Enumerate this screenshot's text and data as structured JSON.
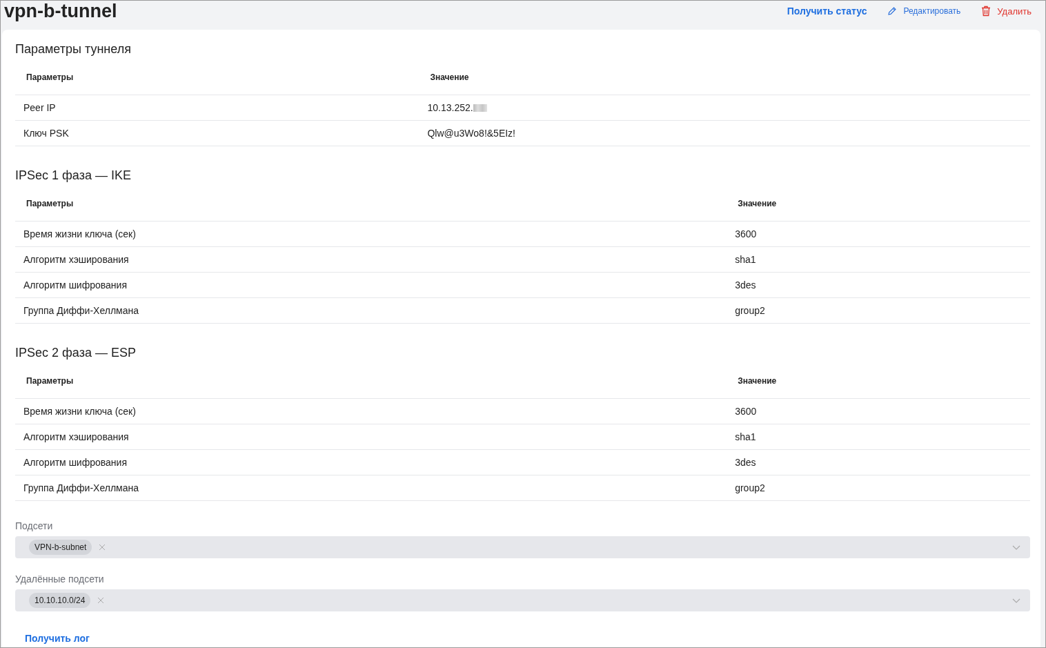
{
  "page": {
    "title": "vpn-b-tunnel",
    "actions": [
      {
        "kind": "status",
        "label": "Получить статус"
      },
      {
        "kind": "edit",
        "label": "Редактировать"
      },
      {
        "kind": "delete",
        "label": "Удалить"
      }
    ]
  },
  "sections": [
    {
      "title": "Параметры туннеля",
      "columns": [
        "Параметры",
        "Значение"
      ],
      "rows": [
        {
          "cells": [
            "Peer IP",
            "10.13.252."
          ],
          "redacted": true
        },
        {
          "cells": [
            "Ключ PSK",
            "Qlw@u3Wo8!&5EIz!"
          ],
          "redacted": false
        }
      ]
    },
    {
      "title": "IPSec 1 фаза — IKE",
      "columns": [
        "Параметры",
        "Значение"
      ],
      "rows": [
        {
          "cells": [
            "Время жизни ключа (сек)",
            "3600"
          ]
        },
        {
          "cells": [
            "Алгоритм хэширования",
            "sha1"
          ]
        },
        {
          "cells": [
            "Алгоритм шифрования",
            "3des"
          ]
        },
        {
          "cells": [
            "Группа Диффи-Хеллмана",
            "group2"
          ]
        }
      ]
    },
    {
      "title": "IPSec 2 фаза — ESP",
      "columns": [
        "Параметры",
        "Значение"
      ],
      "rows": [
        {
          "cells": [
            "Время жизни ключа (сек)",
            "3600"
          ]
        },
        {
          "cells": [
            "Алгоритм хэширования",
            "sha1"
          ]
        },
        {
          "cells": [
            "Алгоритм шифрования",
            "3des"
          ]
        },
        {
          "cells": [
            "Группа Диффи-Хеллмана",
            "group2"
          ]
        }
      ]
    }
  ],
  "fields": [
    {
      "label": "Подсети",
      "tags": [
        "VPN-b-subnet"
      ]
    },
    {
      "label": "Удалённые подсети",
      "tags": [
        "10.10.10.0/24"
      ]
    }
  ],
  "log_link": "Получить лог"
}
